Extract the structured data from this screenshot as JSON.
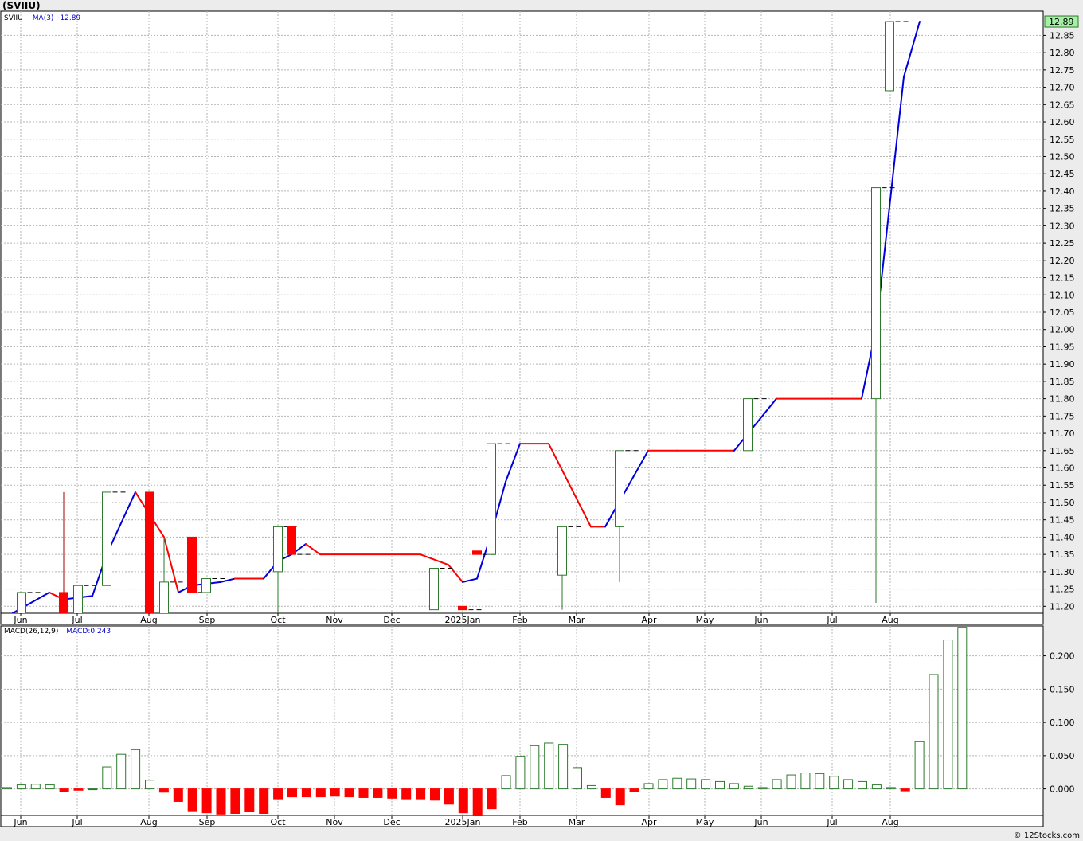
{
  "header": {
    "title": "(SVIIU)",
    "credit": "© 12Stocks.com"
  },
  "price_panel": {
    "ticker_label": "SVIIU",
    "ma_label": "MA(3)",
    "ma_value": "12.89",
    "last_price_label": "12.89"
  },
  "macd_panel": {
    "label": "MACD(26,12,9)",
    "value_label": "MACD:0.243"
  },
  "colors": {
    "up": "#2d7a2d",
    "down": "#ff0000",
    "ma_up": "#0000dd",
    "ma_down": "#ff0000",
    "label_blue": "#0000cc",
    "last_price_bg": "#a6f0a6"
  },
  "chart_data": [
    {
      "type": "candlestick",
      "ylim": [
        11.18,
        12.92
      ],
      "y_ticks": [
        11.2,
        11.25,
        11.3,
        11.35,
        11.4,
        11.45,
        11.5,
        11.55,
        11.6,
        11.65,
        11.7,
        11.75,
        11.8,
        11.85,
        11.9,
        11.95,
        12.0,
        12.05,
        12.1,
        12.15,
        12.2,
        12.25,
        12.3,
        12.35,
        12.4,
        12.45,
        12.5,
        12.55,
        12.6,
        12.65,
        12.7,
        12.75,
        12.8,
        12.85
      ],
      "x_months": [
        "Jun",
        "Jul",
        "Aug",
        "Sep",
        "Oct",
        "Nov",
        "Dec",
        "2025Jan",
        "Feb",
        "Mar",
        "Apr",
        "May",
        "Jun",
        "Jul",
        "Aug"
      ],
      "grid": true,
      "candles": [
        {
          "o": 11.13,
          "h": 11.24,
          "l": 11.13,
          "c": 11.24
        },
        {
          "o": 11.24,
          "h": 11.53,
          "l": 11.13,
          "c": 11.13
        },
        {
          "o": 11.13,
          "h": 11.26,
          "l": 11.13,
          "c": 11.26
        },
        {
          "o": 11.26,
          "h": 11.53,
          "l": 11.26,
          "c": 11.53
        },
        {
          "o": 11.53,
          "h": 11.53,
          "l": 11.13,
          "c": 11.13
        },
        {
          "o": 11.13,
          "h": 11.4,
          "l": 11.13,
          "c": 11.27
        },
        {
          "o": 11.4,
          "h": 11.4,
          "l": 11.24,
          "c": 11.24
        },
        {
          "o": 11.24,
          "h": 11.28,
          "l": 11.24,
          "c": 11.28
        },
        {
          "o": 11.3,
          "h": 11.43,
          "l": 11.18,
          "c": 11.43
        },
        {
          "o": 11.43,
          "h": 11.43,
          "l": 11.35,
          "c": 11.35
        },
        {
          "o": 11.19,
          "h": 11.31,
          "l": 11.19,
          "c": 11.31
        },
        {
          "o": 11.2,
          "h": 11.2,
          "l": 11.19,
          "c": 11.19
        },
        {
          "o": 11.36,
          "h": 11.36,
          "l": 11.35,
          "c": 11.35
        },
        {
          "o": 11.35,
          "h": 11.67,
          "l": 11.35,
          "c": 11.67
        },
        {
          "o": 11.29,
          "h": 11.43,
          "l": 11.19,
          "c": 11.43
        },
        {
          "o": 11.43,
          "h": 11.65,
          "l": 11.27,
          "c": 11.65
        },
        {
          "o": 11.65,
          "h": 11.8,
          "l": 11.65,
          "c": 11.8
        },
        {
          "o": 11.8,
          "h": 12.41,
          "l": 11.21,
          "c": 12.41
        },
        {
          "o": 12.69,
          "h": 12.89,
          "l": 12.69,
          "c": 12.89
        }
      ],
      "ma3": [
        11.17,
        11.24,
        11.22,
        11.23,
        11.35,
        11.53,
        11.4,
        11.24,
        11.26,
        11.27,
        11.28,
        11.28,
        11.33,
        11.35,
        11.38,
        11.35,
        11.35,
        11.35,
        11.32,
        11.27,
        11.28,
        11.41,
        11.56,
        11.67,
        11.67,
        11.43,
        11.43,
        11.65,
        11.65,
        11.65,
        11.8,
        11.8,
        12.0,
        12.73,
        12.89
      ]
    },
    {
      "type": "bar",
      "title": "MACD(26,12,9)",
      "ylim": [
        -0.04,
        0.245
      ],
      "y_ticks": [
        0.0,
        0.05,
        0.1,
        0.15,
        0.2
      ],
      "y_tick_labels": [
        "0.000",
        "0.050",
        "0.100",
        "0.150",
        "0.200"
      ],
      "x_months": [
        "Jun",
        "Jul",
        "Aug",
        "Sep",
        "Oct",
        "Nov",
        "Dec",
        "2025Jan",
        "Feb",
        "Mar",
        "Apr",
        "May",
        "Jun",
        "Jul",
        "Aug"
      ],
      "grid": true,
      "values": [
        0.002,
        0.006,
        0.007,
        0.006,
        -0.004,
        -0.002,
        0.0,
        0.033,
        0.052,
        0.059,
        0.013,
        -0.005,
        -0.019,
        -0.033,
        -0.036,
        -0.038,
        -0.037,
        -0.034,
        -0.037,
        -0.015,
        -0.012,
        -0.012,
        -0.012,
        -0.011,
        -0.012,
        -0.013,
        -0.013,
        -0.014,
        -0.015,
        -0.015,
        -0.017,
        -0.023,
        -0.036,
        -0.04,
        -0.03,
        0.02,
        0.049,
        0.065,
        0.069,
        0.067,
        0.032,
        0.005,
        -0.013,
        -0.024,
        -0.004,
        0.008,
        0.014,
        0.016,
        0.015,
        0.014,
        0.011,
        0.008,
        0.004,
        0.002,
        0.014,
        0.021,
        0.024,
        0.023,
        0.019,
        0.014,
        0.011,
        0.006,
        0.002,
        -0.003,
        0.071,
        0.172,
        0.224,
        0.243
      ]
    }
  ]
}
